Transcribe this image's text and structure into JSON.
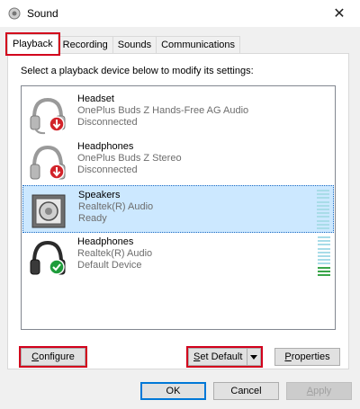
{
  "window": {
    "title": "Sound",
    "close_glyph": "✕"
  },
  "tabs": [
    {
      "label": "Playback",
      "active": true
    },
    {
      "label": "Recording",
      "active": false
    },
    {
      "label": "Sounds",
      "active": false
    },
    {
      "label": "Communications",
      "active": false
    }
  ],
  "instruction": "Select a playback device below to modify its settings:",
  "devices": [
    {
      "name": "Headset",
      "driver": "OnePlus Buds Z Hands-Free AG Audio",
      "status": "Disconnected",
      "icon": "headset-icon",
      "badge": "disconnected-badge-icon",
      "selected": false
    },
    {
      "name": "Headphones",
      "driver": "OnePlus Buds Z Stereo",
      "status": "Disconnected",
      "icon": "headphones-icon",
      "badge": "disconnected-badge-icon",
      "selected": false
    },
    {
      "name": "Speakers",
      "driver": "Realtek(R) Audio",
      "status": "Ready",
      "icon": "speaker-icon",
      "badge": "",
      "selected": true
    },
    {
      "name": "Headphones",
      "driver": "Realtek(R) Audio",
      "status": "Default Device",
      "icon": "headphones-icon",
      "badge": "default-check-badge-icon",
      "selected": false
    }
  ],
  "level_meters": {
    "speakers_level": 0,
    "headphones_default_level": 0.25
  },
  "buttons": {
    "configure": "Configure",
    "set_default": "Set Default",
    "properties": "Properties",
    "ok": "OK",
    "cancel": "Cancel",
    "apply": "Apply"
  },
  "colors": {
    "selection": "#cce8ff",
    "highlight_box": "#d2001c",
    "disconnected_badge": "#d2232a",
    "default_badge": "#1e9c3b",
    "meter_idle": "#a8dce8",
    "meter_active": "#3aa64a"
  }
}
